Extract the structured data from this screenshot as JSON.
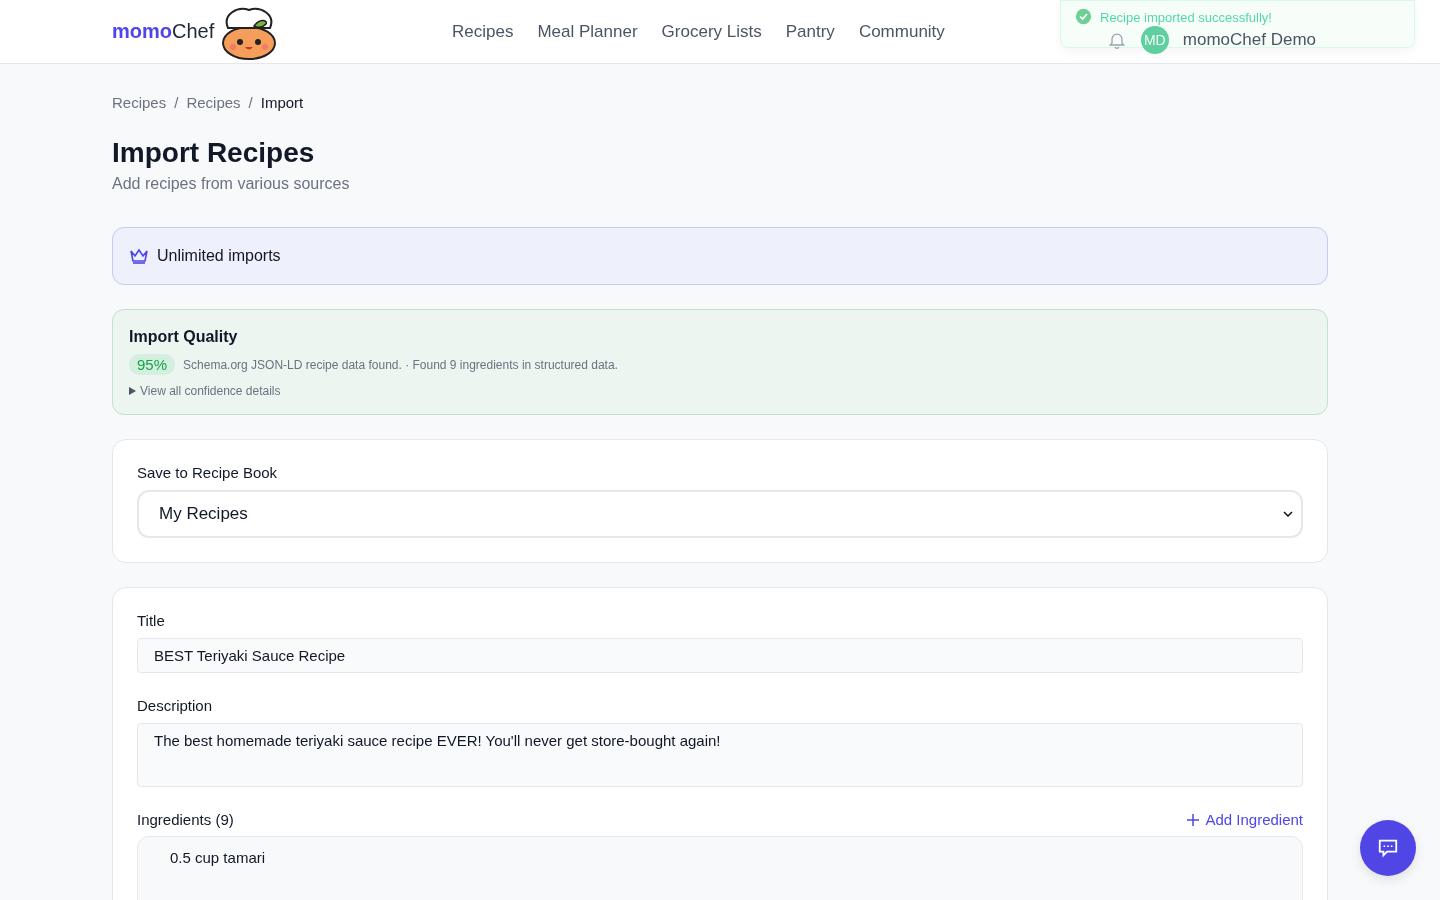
{
  "header": {
    "logo": {
      "bold": "momo",
      "regular": "Chef"
    },
    "nav": [
      {
        "label": "Recipes"
      },
      {
        "label": "Meal Planner"
      },
      {
        "label": "Grocery Lists"
      },
      {
        "label": "Pantry"
      },
      {
        "label": "Community"
      }
    ],
    "user": {
      "initials": "MD",
      "name": "momoChef Demo"
    }
  },
  "toast": {
    "message": "Recipe imported successfully!"
  },
  "breadcrumb_separator": "/",
  "breadcrumb": [
    {
      "label": "Recipes",
      "current": false
    },
    {
      "label": "Recipes",
      "current": false
    },
    {
      "label": "Import",
      "current": true
    }
  ],
  "page": {
    "title": "Import Recipes",
    "subtitle": "Add recipes from various sources"
  },
  "plan_banner": {
    "label": "Unlimited imports"
  },
  "quality": {
    "title": "Import Quality",
    "score": "95%",
    "summary": "Schema.org JSON-LD recipe data found. · Found 9 ingredients in structured data.",
    "details_toggle": "View all confidence details"
  },
  "recipe_book": {
    "label": "Save to Recipe Book",
    "value": "My Recipes"
  },
  "form": {
    "title_label": "Title",
    "title_value": "BEST Teriyaki Sauce Recipe",
    "description_label": "Description",
    "description_value": "The best homemade teriyaki sauce recipe EVER! You'll never get store-bought again!",
    "ingredients_label": "Ingredients (9)",
    "add_ingredient": "Add Ingredient",
    "ingredients": [
      {
        "text": "0.5 cup tamari"
      }
    ]
  }
}
